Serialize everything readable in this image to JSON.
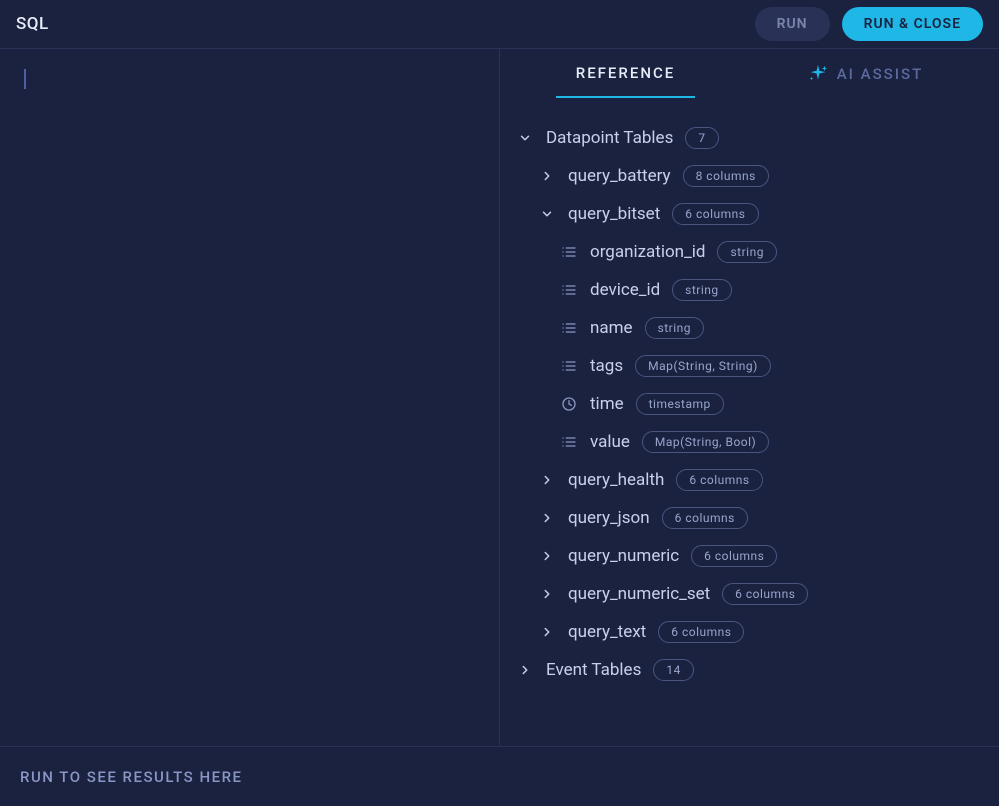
{
  "header": {
    "title": "SQL",
    "run_label": "RUN",
    "run_close_label": "RUN & CLOSE"
  },
  "tabs": {
    "reference": "REFERENCE",
    "ai_assist": "AI ASSIST"
  },
  "tree": {
    "datapoint": {
      "label": "Datapoint Tables",
      "count": "7",
      "tables": [
        {
          "name": "query_battery",
          "columns_label": "8 columns"
        },
        {
          "name": "query_bitset",
          "columns_label": "6 columns"
        },
        {
          "name": "query_health",
          "columns_label": "6 columns"
        },
        {
          "name": "query_json",
          "columns_label": "6 columns"
        },
        {
          "name": "query_numeric",
          "columns_label": "6 columns"
        },
        {
          "name": "query_numeric_set",
          "columns_label": "6 columns"
        },
        {
          "name": "query_text",
          "columns_label": "6 columns"
        }
      ],
      "bitset_columns": [
        {
          "name": "organization_id",
          "type": "string",
          "icon": "list"
        },
        {
          "name": "device_id",
          "type": "string",
          "icon": "list"
        },
        {
          "name": "name",
          "type": "string",
          "icon": "list"
        },
        {
          "name": "tags",
          "type": "Map(String, String)",
          "icon": "list"
        },
        {
          "name": "time",
          "type": "timestamp",
          "icon": "clock"
        },
        {
          "name": "value",
          "type": "Map(String, Bool)",
          "icon": "list"
        }
      ]
    },
    "event": {
      "label": "Event Tables",
      "count": "14"
    }
  },
  "footer": {
    "message": "RUN TO SEE RESULTS HERE"
  }
}
